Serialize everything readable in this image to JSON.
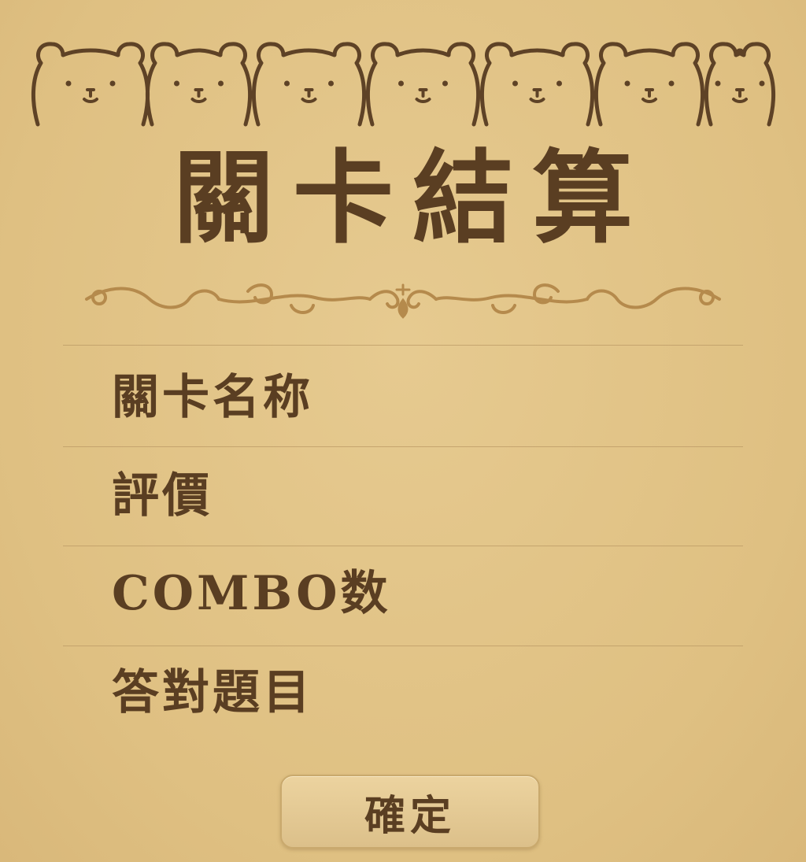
{
  "header": {
    "title": "關卡結算",
    "decoration_icon": "bear-face-border-icon",
    "ornament_icon": "flourish-divider-icon"
  },
  "rows": [
    {
      "label": "關卡名称"
    },
    {
      "label": "評價"
    },
    {
      "label": "COMBO数"
    },
    {
      "label": "答對題目"
    }
  ],
  "footer": {
    "confirm_label": "確定"
  },
  "colors": {
    "background": "#e1c387",
    "ink": "#5a3e22",
    "ornament": "#b58a4c",
    "divider": "#bb9a66"
  }
}
